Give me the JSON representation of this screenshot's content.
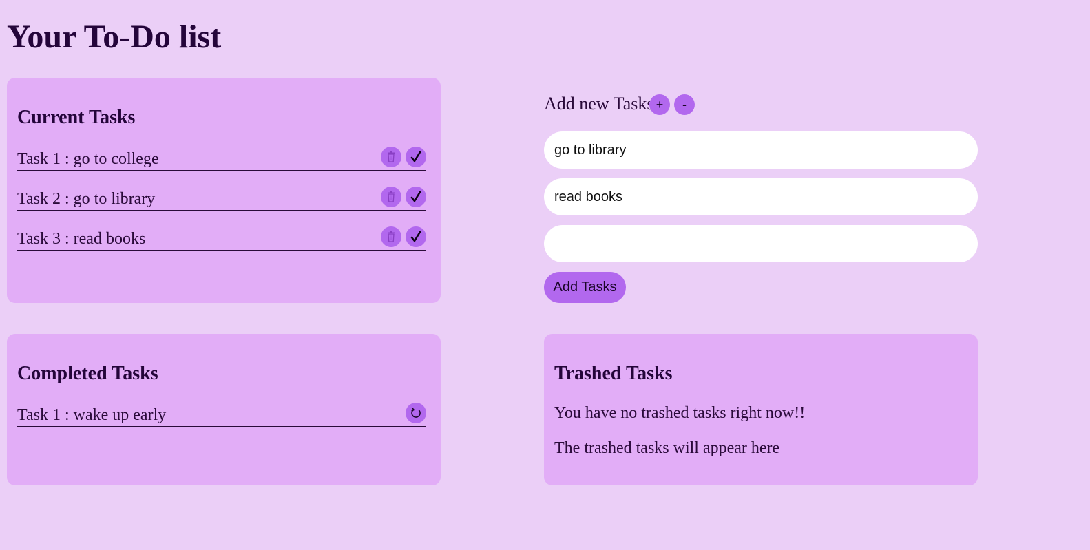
{
  "page": {
    "title": "Your To-Do list"
  },
  "current_tasks": {
    "heading": "Current Tasks",
    "items": [
      {
        "label": "Task 1 : go to college"
      },
      {
        "label": "Task 2 : go to library"
      },
      {
        "label": "Task 3 : read books"
      }
    ],
    "delete_icon": "trash-icon",
    "complete_icon": "check-icon"
  },
  "add_form": {
    "label": "Add new Tasks",
    "plus_label": "+",
    "minus_label": "-",
    "inputs": [
      {
        "value": "go to library"
      },
      {
        "value": "read books"
      },
      {
        "value": ""
      }
    ],
    "submit_label": "Add Tasks"
  },
  "completed_tasks": {
    "heading": "Completed Tasks",
    "items": [
      {
        "label": "Task 1 : wake up early"
      }
    ],
    "restore_icon": "undo-icon"
  },
  "trashed_tasks": {
    "heading": "Trashed Tasks",
    "message_1": "You have no trashed tasks right now!!",
    "message_2": "The trashed tasks will appear here"
  },
  "colors": {
    "background": "#ebcff7",
    "panel": "#e2adf7",
    "accent": "#b268ee",
    "text": "#24053a"
  }
}
